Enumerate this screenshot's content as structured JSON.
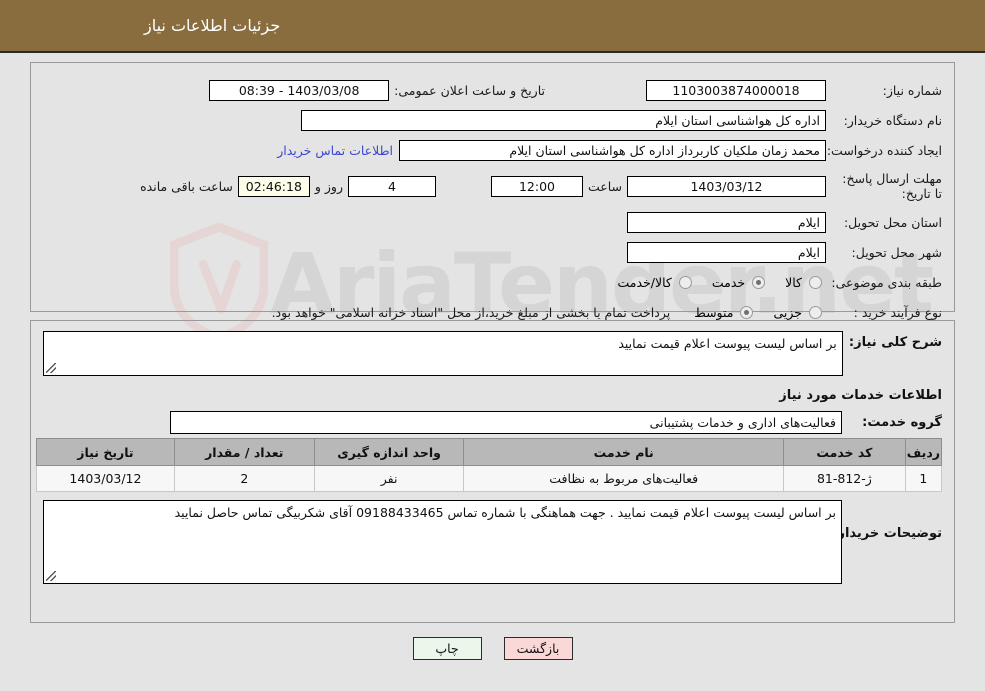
{
  "header": {
    "title": "جزئیات اطلاعات نیاز",
    "bg_color": "#8a6d3f"
  },
  "watermark": {
    "text": "AriaTender.net",
    "logo_color": "#e8c6c6"
  },
  "info": {
    "need_number_label": "شماره نیاز:",
    "need_number_value": "1103003874000018",
    "announce_label": "تاریخ و ساعت اعلان عمومی:",
    "announce_value": "1403/03/08 - 08:39",
    "buyer_org_label": "نام دستگاه خریدار:",
    "buyer_org_value": "اداره کل هواشناسی استان ایلام",
    "creator_label": "ایجاد کننده درخواست:",
    "creator_value": "محمد زمان ملکیان کاربرداز اداره کل هواشناسی استان ایلام",
    "contact_link": "اطلاعات تماس خریدار",
    "deadline_label": "مهلت ارسال پاسخ: تا تاریخ:",
    "deadline_date": "1403/03/12",
    "deadline_hour_label": "ساعت",
    "deadline_time": "12:00",
    "remaining_days": "4",
    "remaining_days_label": "روز و",
    "remaining_time": "02:46:18",
    "remaining_suffix_label": "ساعت باقی مانده",
    "province_label": "استان محل تحویل:",
    "province_value": "ایلام",
    "city_label": "شهر محل تحویل:",
    "city_value": "ایلام",
    "classification_label": "طبقه بندی موضوعی:",
    "classification_options": [
      {
        "label": "کالا",
        "selected": false
      },
      {
        "label": "خدمت",
        "selected": true
      },
      {
        "label": "کالا/خدمت",
        "selected": false
      }
    ],
    "process_label": "نوع فرآیند خرید :",
    "process_options": [
      {
        "label": "جزیی",
        "selected": false
      },
      {
        "label": "متوسط",
        "selected": true
      }
    ],
    "treasury_note": "پرداخت تمام یا بخشی از مبلغ خرید،از محل \"اسناد خزانه اسلامی\" خواهد بود."
  },
  "need_description": {
    "label": "شرح کلی نیاز:",
    "value": "بر اساس لیست پیوست اعلام قیمت نمایید"
  },
  "services_section": {
    "title": "اطلاعات خدمات مورد نیاز",
    "group_label": "گروه خدمت:",
    "group_value": "فعالیت‌های اداری و خدمات پشتیبانی"
  },
  "table": {
    "headers": [
      "ردیف",
      "کد خدمت",
      "نام خدمت",
      "واحد اندازه گیری",
      "تعداد / مقدار",
      "تاریخ نیاز"
    ],
    "rows": [
      {
        "index": "1",
        "code": "ژ-812-81",
        "name": "فعالیت‌های مربوط به نظافت",
        "unit": "نفر",
        "quantity": "2",
        "date": "1403/03/12"
      }
    ]
  },
  "buyer_notes": {
    "label": "توضیحات خریدار:",
    "value": "بر اساس لیست پیوست اعلام قیمت نمایید . جهت هماهنگی با شماره تماس 09188433465 آقای شکربیگی تماس حاصل نمایید"
  },
  "footer": {
    "print_label": "چاپ",
    "back_label": "بازگشت"
  }
}
